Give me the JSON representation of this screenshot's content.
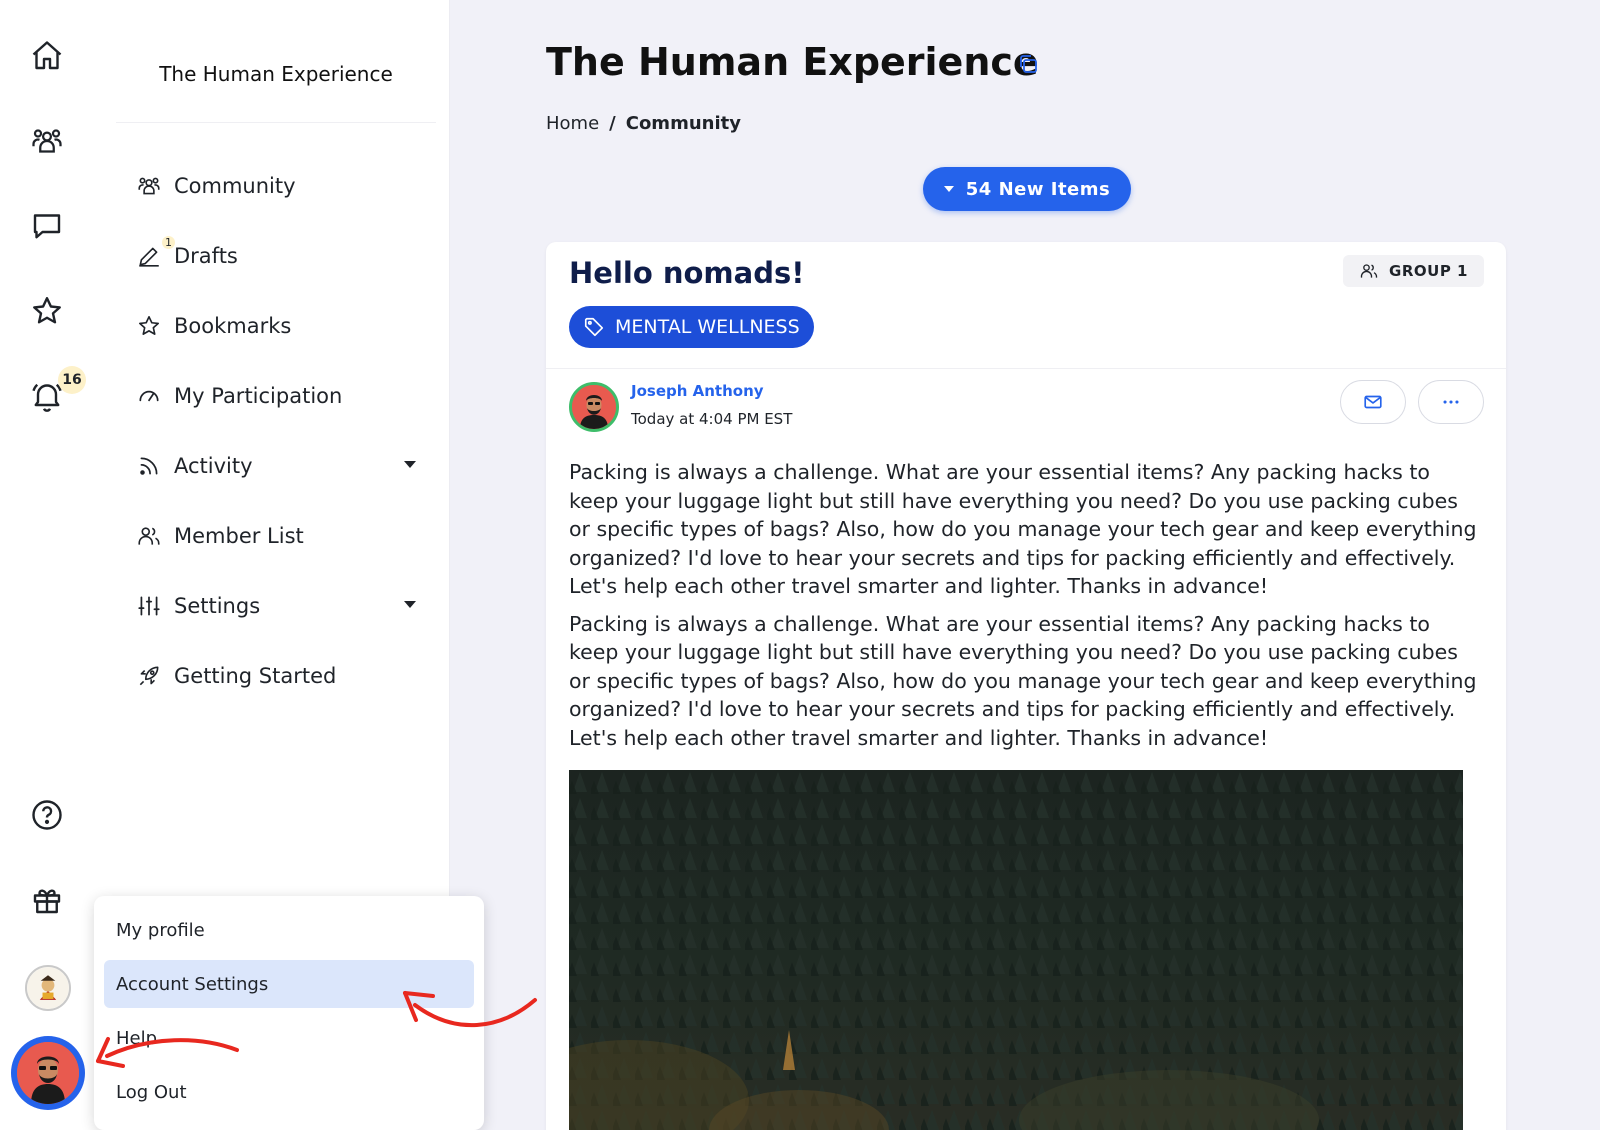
{
  "rail": {
    "items": [
      {
        "name": "home",
        "icon": "home-icon"
      },
      {
        "name": "groups",
        "icon": "groups-icon"
      },
      {
        "name": "messages",
        "icon": "chat-icon"
      },
      {
        "name": "favorites",
        "icon": "star-icon"
      },
      {
        "name": "notifications",
        "icon": "bell-icon",
        "badge": "16"
      },
      {
        "name": "help",
        "icon": "question-icon"
      },
      {
        "name": "rewards",
        "icon": "gift-icon"
      }
    ],
    "notification_badge": "16"
  },
  "sidebar": {
    "title": "The Human Experience",
    "items": [
      {
        "label": "Community",
        "icon": "community-icon"
      },
      {
        "label": "Drafts",
        "icon": "pencil-icon",
        "badge": "1"
      },
      {
        "label": "Bookmarks",
        "icon": "star-icon"
      },
      {
        "label": "My Participation",
        "icon": "gauge-icon"
      },
      {
        "label": "Activity",
        "icon": "rss-icon",
        "expandable": true
      },
      {
        "label": "Member List",
        "icon": "members-icon"
      },
      {
        "label": "Settings",
        "icon": "sliders-icon",
        "expandable": true
      },
      {
        "label": "Getting Started",
        "icon": "rocket-icon"
      }
    ]
  },
  "header": {
    "title": "The Human Experience",
    "breadcrumb": {
      "home": "Home",
      "separator": "/",
      "current": "Community"
    },
    "new_items_label": "54 New Items"
  },
  "post": {
    "title": "Hello nomads!",
    "group": "GROUP 1",
    "tag": "MENTAL WELLNESS",
    "author": "Joseph Anthony",
    "time": "Today at 4:04 PM EST",
    "paragraphs": [
      "Packing is always a challenge. What are your essential items? Any packing hacks to keep your luggage light but still have everything you need? Do you use packing cubes or specific types of bags? Also, how do you manage your tech gear and keep everything organized? I'd love to hear your secrets and tips for packing efficiently and effectively. Let's help each other travel smarter and lighter. Thanks in advance!",
      "Packing is always a challenge. What are your essential items? Any packing hacks to keep your luggage light but still have everything you need? Do you use packing cubes or specific types of bags? Also, how do you manage your tech gear and keep everything organized? I'd love to hear your secrets and tips for packing efficiently and effectively. Let's help each other travel smarter and lighter. Thanks in advance!"
    ]
  },
  "profile_menu": {
    "items": [
      {
        "label": "My profile",
        "active": false
      },
      {
        "label": "Account Settings",
        "active": true
      },
      {
        "label": "Help",
        "active": false
      },
      {
        "label": "Log Out",
        "active": false
      }
    ]
  },
  "colors": {
    "accent": "#2563eb",
    "tag": "#1d4ed8",
    "title_navy": "#0f1d4a",
    "badge": "#fdf1c9",
    "annotation_arrow": "#e8281f",
    "menu_active": "#dbe6fb"
  }
}
